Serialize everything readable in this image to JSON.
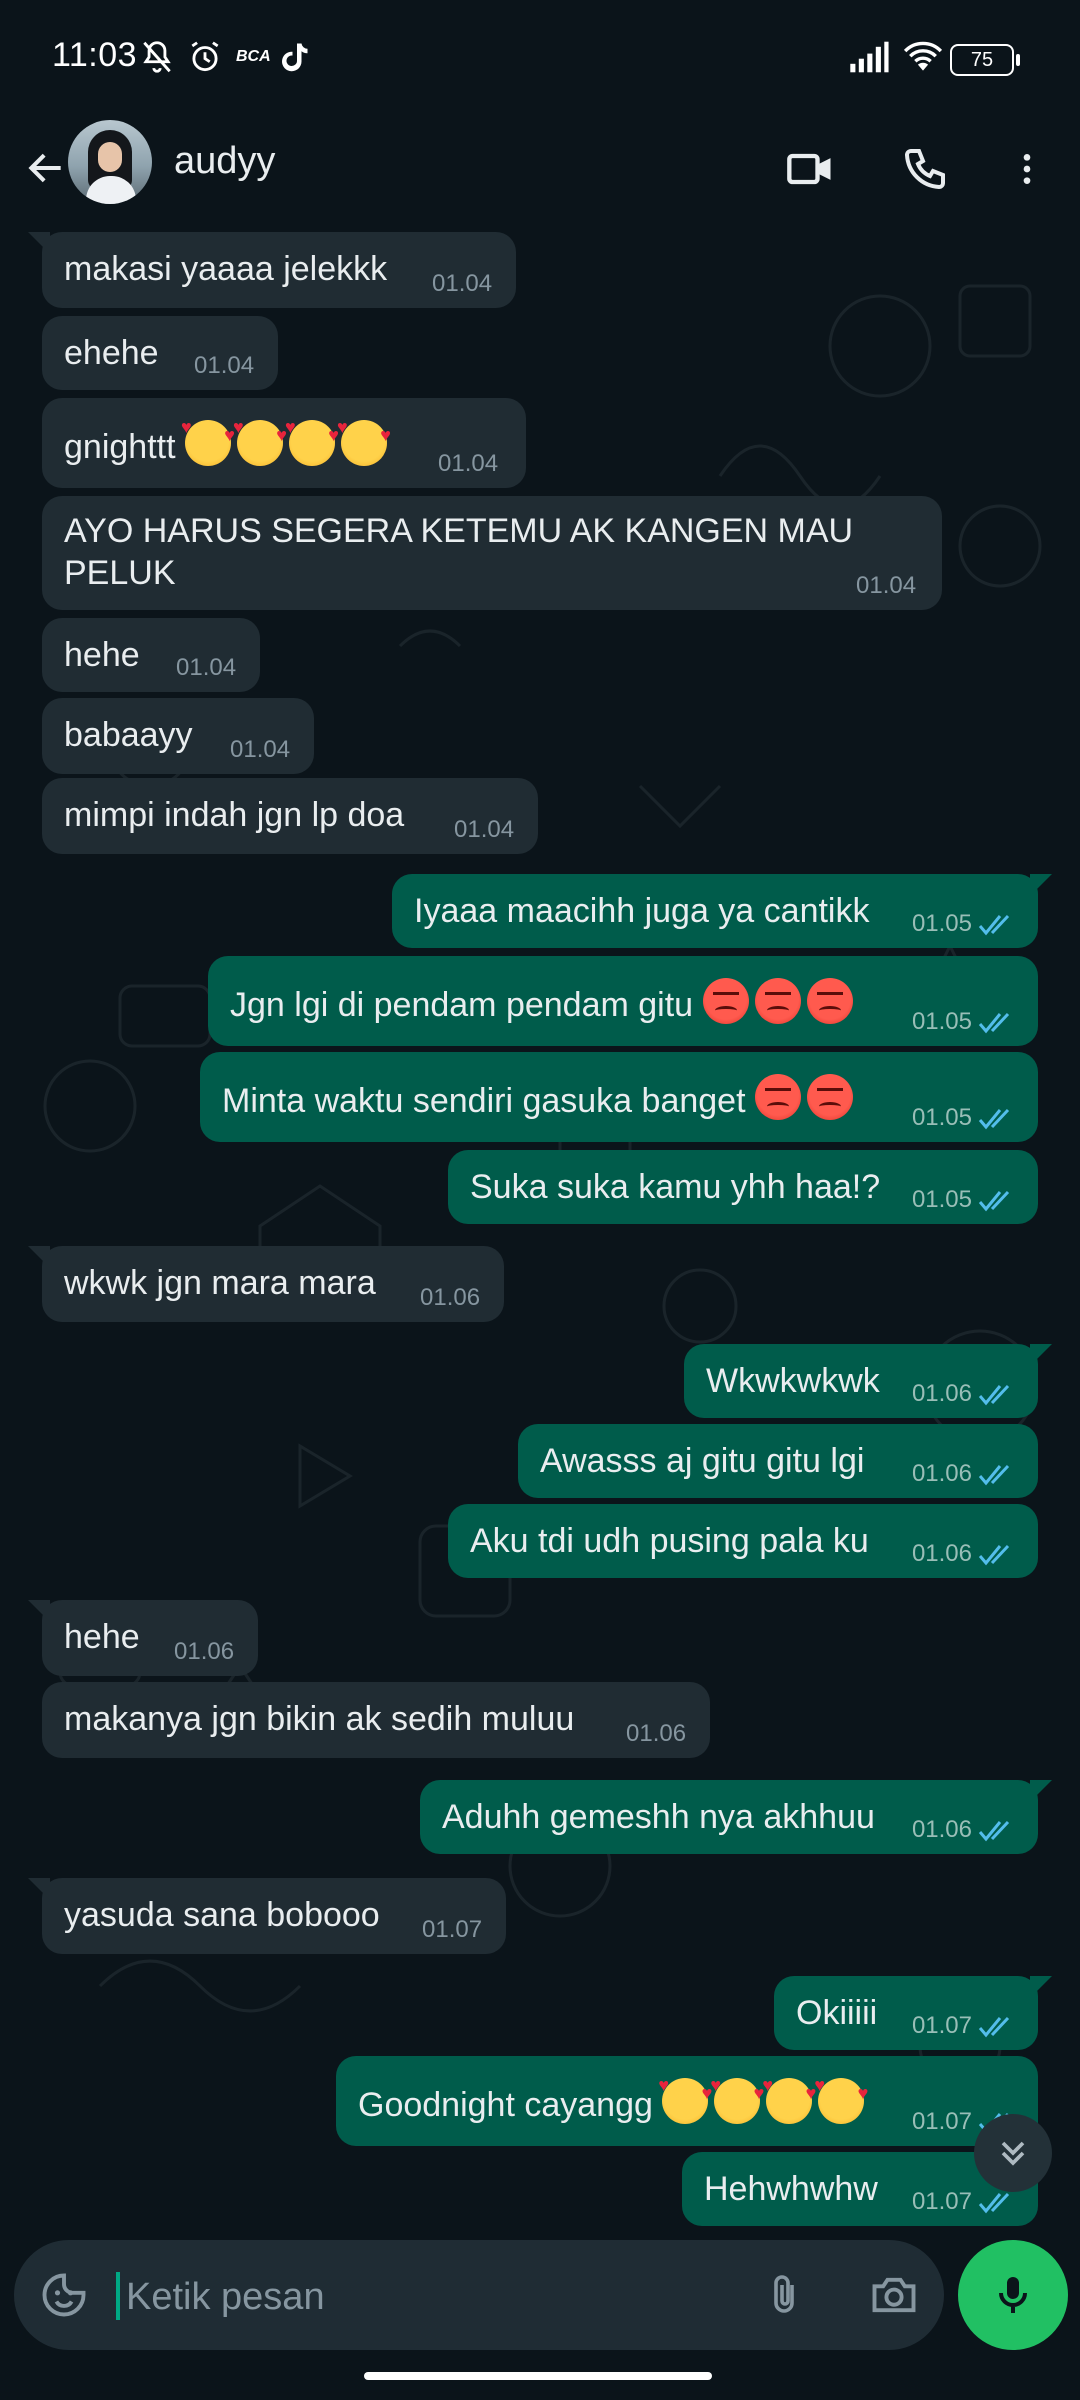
{
  "status_bar": {
    "time": "11:03",
    "battery": "75",
    "icons": [
      "mute-icon",
      "alarm-icon",
      "bca-icon",
      "tiktok-icon",
      "signal-icon",
      "wifi-icon",
      "battery-icon"
    ],
    "bca_label": "BCA"
  },
  "header": {
    "contact_name": "audyy",
    "icons": [
      "back-arrow-icon",
      "video-call-icon",
      "voice-call-icon",
      "more-options-icon"
    ]
  },
  "messages": [
    {
      "dir": "in",
      "text": "makasi yaaaa jelekkk",
      "time": "01.04"
    },
    {
      "dir": "in",
      "text": "ehehe",
      "time": "01.04"
    },
    {
      "dir": "in",
      "text": "gnighttt",
      "emoji": [
        "smiling-face-with-hearts",
        "smiling-face-with-hearts",
        "smiling-face-with-hearts",
        "smiling-face-with-hearts"
      ],
      "time": "01.04"
    },
    {
      "dir": "in",
      "text": "AYO HARUS SEGERA KETEMU AK KANGEN MAU",
      "text2": "PELUK",
      "time": "01.04"
    },
    {
      "dir": "in",
      "text": "hehe",
      "time": "01.04"
    },
    {
      "dir": "in",
      "text": "babaayy",
      "time": "01.04"
    },
    {
      "dir": "in",
      "text": "mimpi indah jgn lp doa",
      "time": "01.04"
    },
    {
      "dir": "out",
      "text": "Iyaaa maacihh juga ya cantikk",
      "time": "01.05",
      "read": true
    },
    {
      "dir": "out",
      "text": "Jgn lgi di pendam pendam gitu",
      "emoji": [
        "angry-face",
        "angry-face",
        "angry-face"
      ],
      "time": "01.05",
      "read": true
    },
    {
      "dir": "out",
      "text": "Minta waktu sendiri gasuka banget",
      "emoji": [
        "angry-face",
        "angry-face"
      ],
      "time": "01.05",
      "read": true
    },
    {
      "dir": "out",
      "text": "Suka suka kamu yhh haa!?",
      "time": "01.05",
      "read": true
    },
    {
      "dir": "in",
      "text": "wkwk jgn mara mara",
      "time": "01.06"
    },
    {
      "dir": "out",
      "text": "Wkwkwkwk",
      "time": "01.06",
      "read": true
    },
    {
      "dir": "out",
      "text": "Awasss aj gitu gitu lgi",
      "time": "01.06",
      "read": true
    },
    {
      "dir": "out",
      "text": "Aku tdi udh pusing pala ku",
      "time": "01.06",
      "read": true
    },
    {
      "dir": "in",
      "text": "hehe",
      "time": "01.06"
    },
    {
      "dir": "in",
      "text": "makanya jgn bikin ak sedih muluu",
      "time": "01.06"
    },
    {
      "dir": "out",
      "text": "Aduhh gemeshh nya akhhuu",
      "time": "01.06",
      "read": true
    },
    {
      "dir": "in",
      "text": "yasuda sana bobooo",
      "time": "01.07"
    },
    {
      "dir": "out",
      "text": "Okiiiii",
      "time": "01.07",
      "read": true
    },
    {
      "dir": "out",
      "text": "Goodnight cayangg",
      "emoji": [
        "smiling-face-with-hearts",
        "smiling-face-with-hearts",
        "smiling-face-with-hearts",
        "smiling-face-with-hearts"
      ],
      "time": "01.07",
      "read": true
    },
    {
      "dir": "out",
      "text": "Hehwhwhw",
      "time": "01.07",
      "read": true
    }
  ],
  "input": {
    "placeholder": "Ketik pesan",
    "icons": [
      "emoji-sticker-icon",
      "attach-icon",
      "camera-icon",
      "mic-icon"
    ]
  },
  "colors": {
    "background": "#0b141a",
    "incoming_bubble": "#202c33",
    "outgoing_bubble": "#005c4b",
    "read_tick": "#53bdeb",
    "accent": "#21c063"
  }
}
